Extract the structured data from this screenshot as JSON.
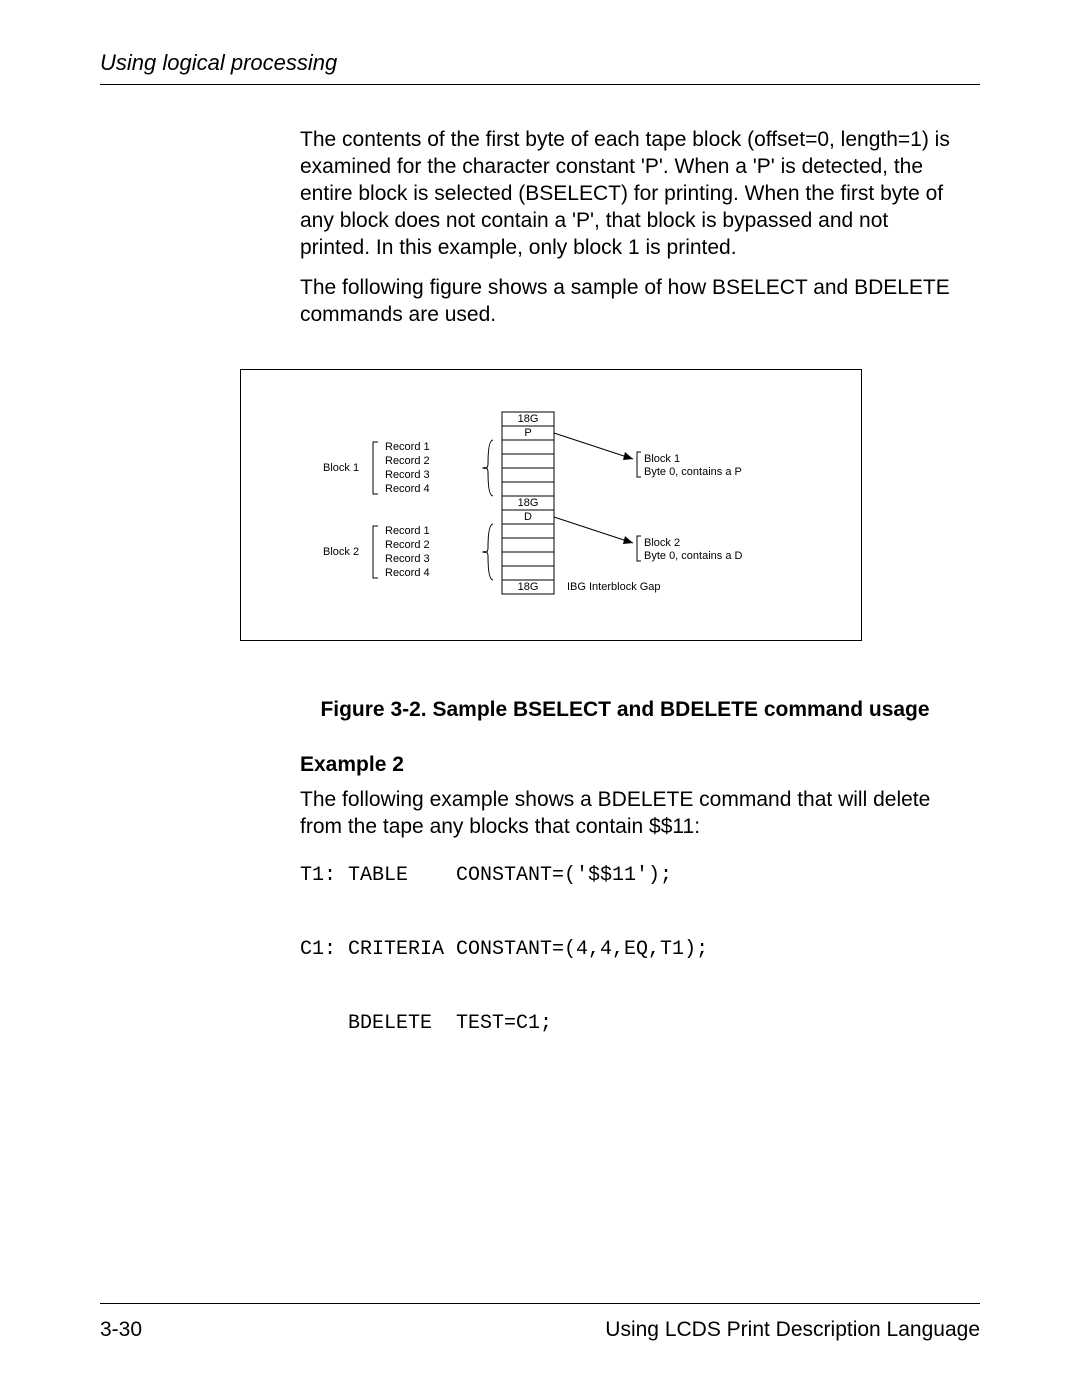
{
  "header": {
    "title": "Using logical processing"
  },
  "paragraphs": {
    "p1": "The contents of the first byte of each tape block (offset=0, length=1) is examined for the character constant 'P'. When a 'P' is detected, the entire block is selected (BSELECT) for printing. When the first byte of any block does not contain a 'P', that block is bypassed and not printed. In this example, only block 1 is printed.",
    "p2": "The following figure shows a sample of how BSELECT and BDELETE commands are used.",
    "p3": "The following example shows a BDELETE command that will delete from the tape any blocks that contain $$11:"
  },
  "figure": {
    "caption": "Figure 3-2. Sample BSELECT and BDELETE command usage",
    "labels": {
      "gap1": "18G",
      "byte1": "P",
      "gap2": "18G",
      "byte2": "D",
      "gap3": "18G",
      "block1": "Block 1",
      "block2": "Block 2",
      "records": [
        "Record 1",
        "Record 2",
        "Record 3",
        "Record 4"
      ],
      "note1a": "Block 1",
      "note1b": "Byte 0, contains a P",
      "note2a": "Block 2",
      "note2b": "Byte 0, contains a D",
      "ibg": "IBG Interblock Gap"
    }
  },
  "example": {
    "heading": "Example 2",
    "code": "T1: TABLE    CONSTANT=('$$11');\n\nC1: CRITERIA CONSTANT=(4,4,EQ,T1);\n\n    BDELETE  TEST=C1;"
  },
  "footer": {
    "left": "3-30",
    "right": "Using LCDS Print Description Language"
  }
}
